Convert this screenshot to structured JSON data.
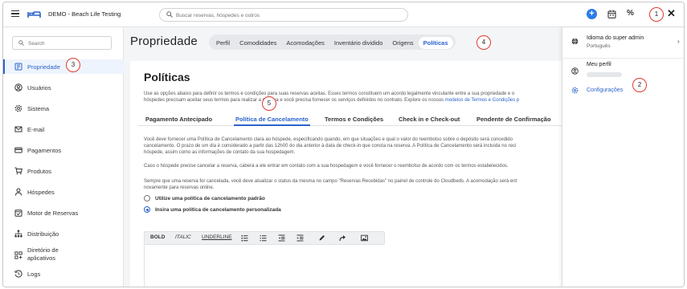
{
  "app": {
    "title": "DEMO - Beach Life Testing"
  },
  "topbar": {
    "search_placeholder": "Buscar reservas, hóspedes e outros",
    "percent_label": "%",
    "close_label": "✕",
    "plus_label": "+"
  },
  "sidebar": {
    "search_placeholder": "Search",
    "items": [
      {
        "label": "Propriedade",
        "icon": "building-icon",
        "active": true
      },
      {
        "label": "Usuários",
        "icon": "user-circle-icon"
      },
      {
        "label": "Sistema",
        "icon": "gear-icon"
      },
      {
        "label": "E-mail",
        "icon": "envelope-icon"
      },
      {
        "label": "Pagamentos",
        "icon": "credit-card-icon"
      },
      {
        "label": "Produtos",
        "icon": "cart-icon"
      },
      {
        "label": "Hóspedes",
        "icon": "person-icon"
      },
      {
        "label": "Motor de Reservas",
        "icon": "calendar-check-icon"
      },
      {
        "label": "Distribuição",
        "icon": "sitemap-icon"
      },
      {
        "label_line1": "Diretório de",
        "label_line2": "aplicativos",
        "icon": "apps-grid-icon"
      },
      {
        "label": "Logs",
        "icon": "history-icon"
      }
    ]
  },
  "property": {
    "title": "Propriedade",
    "tabs": [
      "Perfil",
      "Comodidades",
      "Acomodações",
      "Inventário dividido",
      "Origens",
      "Políticas"
    ],
    "active_tab": "Políticas"
  },
  "policies": {
    "title": "Políticas",
    "intro_line1": "Use as opções abaixo para definir os termos e condições para suas reservas aceitas. Esses termos constituem um acordo legalmente vinculante entre a sua propriedade e o",
    "intro_line2a": "hóspedes precisam aceitar seus termos para realizar a reserva e você precisa fornecer os serviços definidos no contrato. Explore os nossos",
    "intro_link": "modelos de Termos e Condições p",
    "tabs": [
      "Pagamento Antecipado",
      "Política de Cancelamento",
      "Termos e Condições",
      "Check in e Check-out",
      "Pendente de Confirmação"
    ],
    "active_tab": "Política de Cancelamento",
    "para1_line1": "Você deve fornecer uma Política de Cancelamento clara ao hóspede, especificando quando, em que situações e qual o valor do reembolso sobre o depósito será concedido",
    "para1_line2": "cancelamento. O prazo de um dia é considerado a partir das 12h00 do dia anterior à data de check-in que consta na reserva. A Política de Cancelamento será incluída no reci",
    "para1_line3": "hóspede, assim como as informações de contato da sua hospedagem.",
    "para2": "Caso o hóspede precise cancelar a reserva, caberá a ele entrar em contato com a sua hospedagem e você fornecer o reembolso de acordo com os termos estabelecidos.",
    "para3_line1": "Sempre que uma reserva for cancelada, você deve atualizar o status da mesma no campo \"Reservas Recebidas\" no painel de controle do Cloudbeds. A acomodação será ent",
    "para3_line2": "novamente para reservas online.",
    "radio_default": "Utilize uma política de cancelamento padrão",
    "radio_custom": "Insira uma política de cancelamento personalizada",
    "radio_selected": "custom",
    "toolbar": {
      "bold": "BOLD",
      "italic": "ITALIC",
      "underline": "UNDERLINE"
    }
  },
  "dropdown": {
    "language_label": "Idioma do super admin",
    "language_value": "Português",
    "profile_label": "Meu perfil",
    "settings_label": "Configurações"
  },
  "annotations": [
    "1",
    "2",
    "3",
    "4",
    "5"
  ],
  "colors": {
    "accent": "#2b63c9",
    "annotation": "#e03a2f",
    "plus_button": "#2b7be5"
  }
}
